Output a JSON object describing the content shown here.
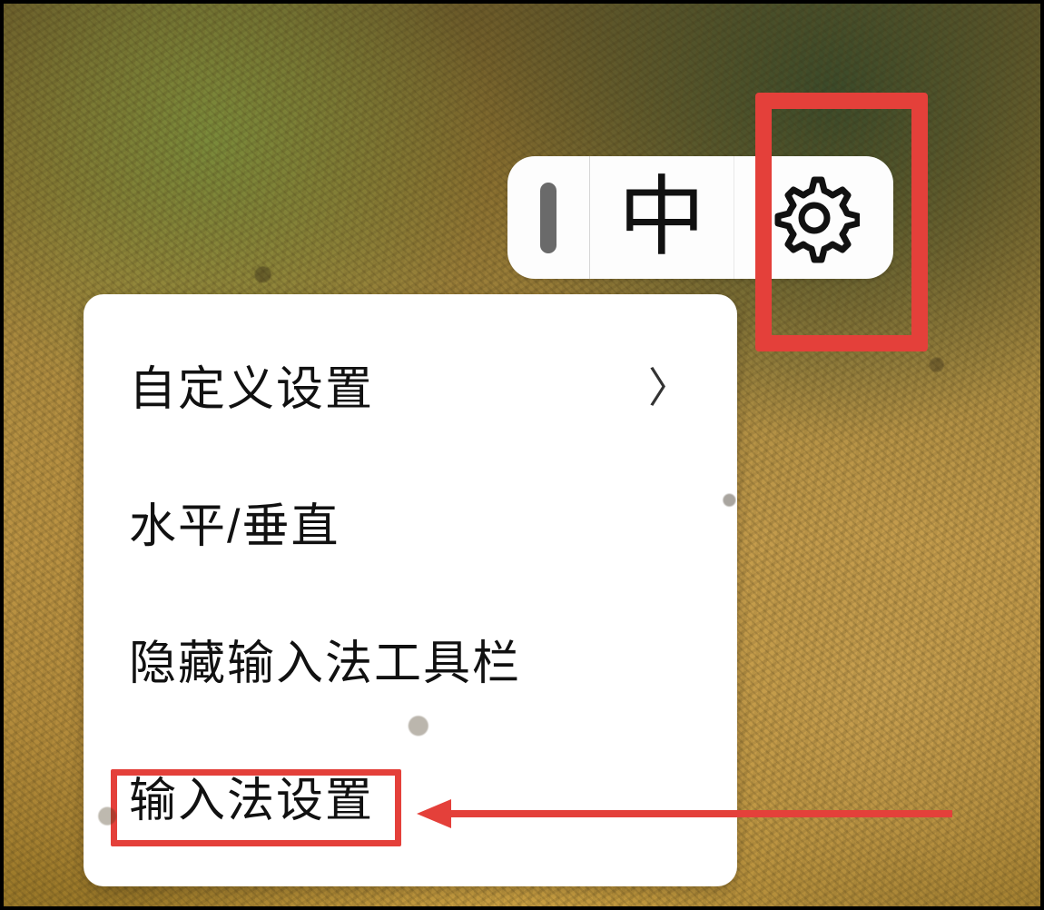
{
  "ime_bar": {
    "language_indicator": "中"
  },
  "menu": {
    "items": [
      {
        "label": "自定义设置",
        "has_submenu": true
      },
      {
        "label": "水平/垂直",
        "has_submenu": false
      },
      {
        "label": "隐藏输入法工具栏",
        "has_submenu": false
      },
      {
        "label": "输入法设置",
        "has_submenu": false
      }
    ]
  },
  "annotations": {
    "highlight_color": "#e4403a"
  }
}
